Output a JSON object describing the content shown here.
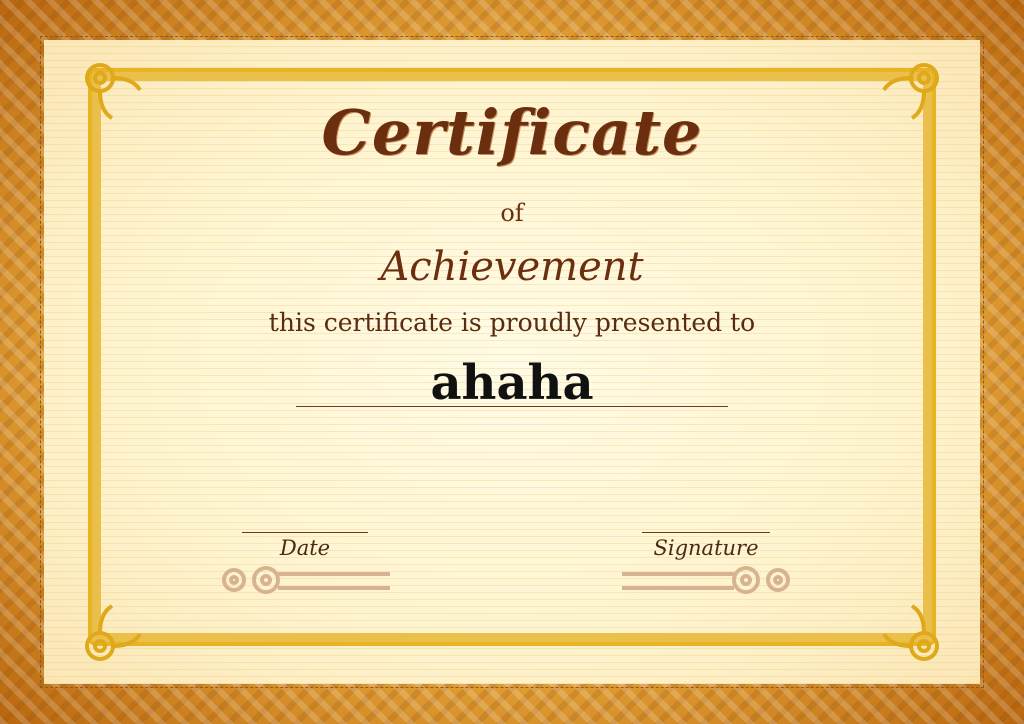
{
  "certificate": {
    "title": "Certificate",
    "of": "of",
    "subtitle": "Achievement",
    "presented_text": "this certificate is proudly presented to",
    "recipient": "ahaha",
    "date_label": "Date",
    "signature_label": "Signature"
  },
  "colors": {
    "frame_gold": "#e8a93b",
    "inner_border": "#e8b423",
    "title_brown": "#6b2f0f",
    "paper": "#fff4d0",
    "ornament": "#c9a27a"
  },
  "icons": [
    "corner-swirl-icon",
    "date-flourish-icon",
    "signature-flourish-icon"
  ]
}
